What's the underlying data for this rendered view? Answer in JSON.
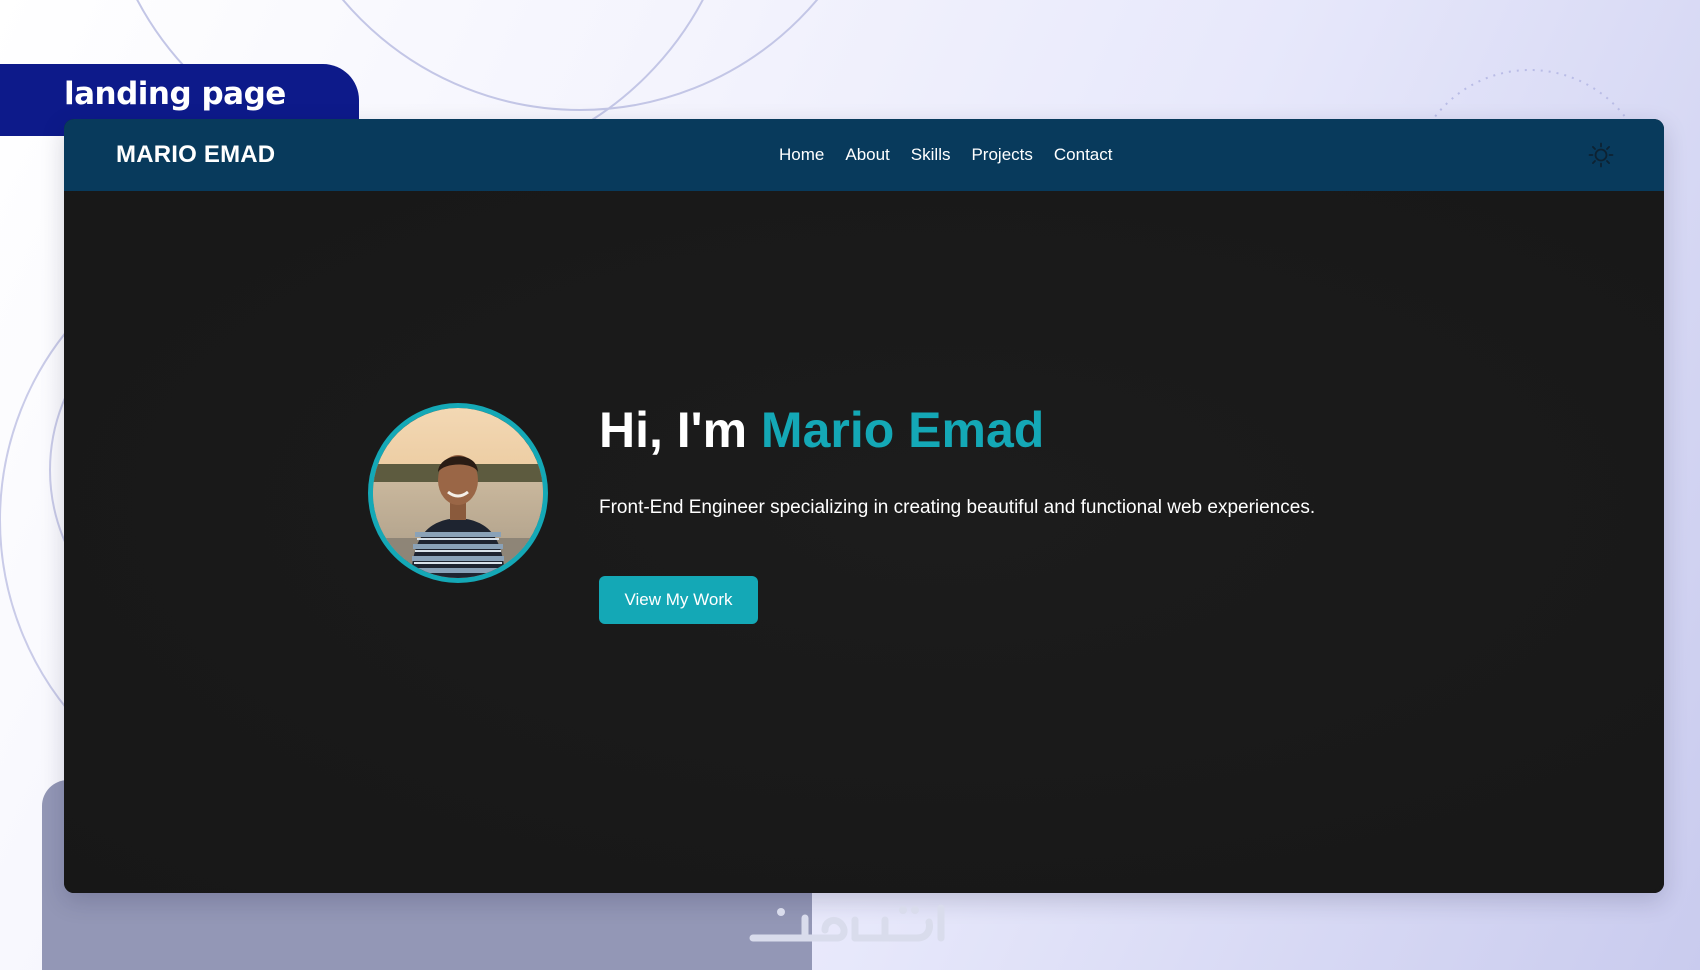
{
  "slide": {
    "label": "landing page"
  },
  "site": {
    "brand": "MARIO EMAD",
    "nav": [
      {
        "label": "Home"
      },
      {
        "label": "About"
      },
      {
        "label": "Skills"
      },
      {
        "label": "Projects"
      },
      {
        "label": "Contact"
      }
    ],
    "theme_toggle_icon": "sun-icon"
  },
  "hero": {
    "greeting": "Hi, I'm ",
    "name": "Mario Emad",
    "subtitle": "Front-End Engineer specializing in creating beautiful and functional web experiences.",
    "cta_label": "View My Work",
    "avatar_icon": "profile-photo"
  },
  "colors": {
    "accent": "#14a8b6",
    "navbar": "#083a5c",
    "hero_bg": "#1a1a1a",
    "label_tab": "#0d1a8a"
  },
  "watermark_icon": "khamsat-logo-watermark"
}
